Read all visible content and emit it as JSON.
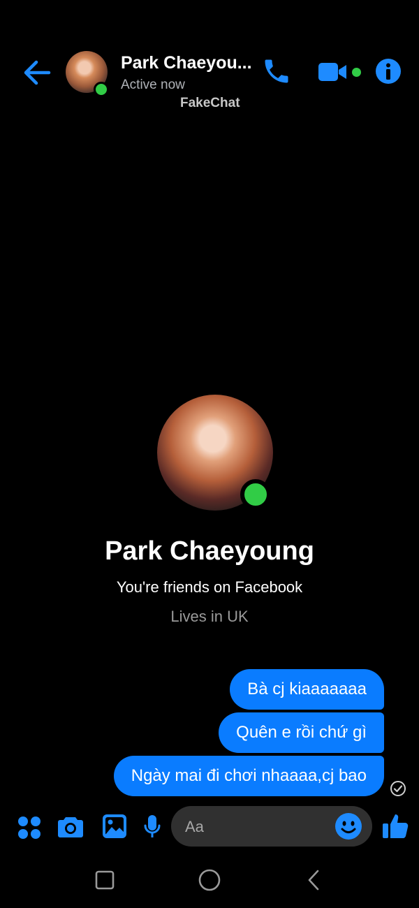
{
  "header": {
    "contact_name": "Park Chaeyou...",
    "status": "Active now",
    "watermark": "FakeChat"
  },
  "profile": {
    "name": "Park Chaeyoung",
    "relation": "You're friends on Facebook",
    "location": "Lives in UK"
  },
  "messages": [
    {
      "text": "Bà cj kiaaaaaaa",
      "sender": "me"
    },
    {
      "text": "Quên e rồi chứ gì",
      "sender": "me"
    },
    {
      "text": "Ngày mai đi chơi nhaaaa,cj bao",
      "sender": "me"
    }
  ],
  "composer": {
    "placeholder": "Aa"
  },
  "icons": {
    "back": "arrow-left-icon",
    "call": "phone-icon",
    "video": "video-camera-icon",
    "info": "info-icon",
    "menu": "four-dots-icon",
    "camera": "camera-icon",
    "gallery": "image-icon",
    "mic": "microphone-icon",
    "emoji": "smiley-icon",
    "like": "thumbs-up-icon",
    "seen": "check-circle-icon"
  },
  "colors": {
    "accent": "#0a7cff",
    "online": "#31cc46",
    "background": "#000000"
  }
}
